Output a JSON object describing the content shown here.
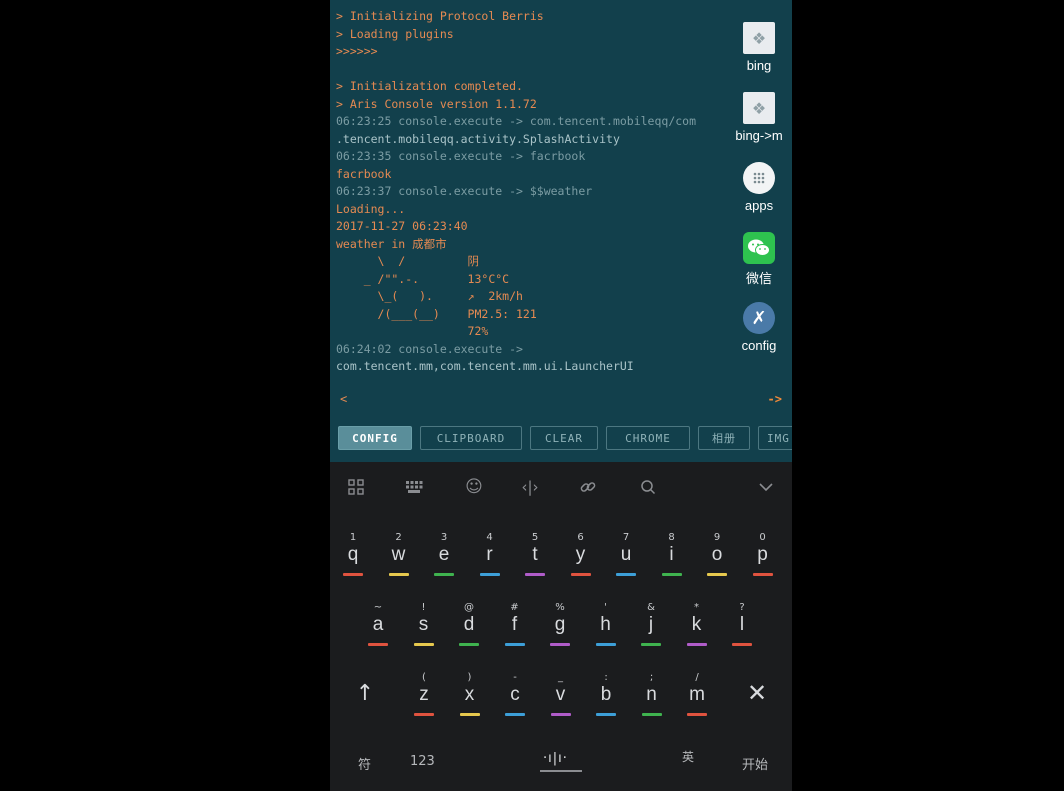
{
  "console": {
    "lines": [
      {
        "text": "> Initializing Protocol Berris",
        "color": "#e58a52"
      },
      {
        "text": "> Loading plugins",
        "color": "#e58a52"
      },
      {
        "text": ">>>>>>",
        "color": "#e58a52"
      },
      {
        "text": "",
        "color": "#e58a52"
      },
      {
        "text": "> Initialization completed.",
        "color": "#e58a52"
      },
      {
        "text": "> Aris Console version 1.1.72",
        "color": "#e58a52"
      },
      {
        "text": "06:23:25 console.execute -> com.tencent.mobileqq/com",
        "color": "#7b9ca3"
      },
      {
        "text": ".tencent.mobileqq.activity.SplashActivity",
        "color": "#a9c3c8"
      },
      {
        "text": "06:23:35 console.execute -> facrbook",
        "color": "#7b9ca3"
      },
      {
        "text": "facrbook",
        "color": "#e58a52"
      },
      {
        "text": "06:23:37 console.execute -> $$weather",
        "color": "#7b9ca3"
      },
      {
        "text": "Loading...",
        "color": "#e58a52"
      },
      {
        "text": "2017-11-27 06:23:40",
        "color": "#e58a52"
      },
      {
        "text": "weather in 成都市",
        "color": "#e58a52"
      },
      {
        "text": "      \\  /         阴",
        "color": "#e58a52"
      },
      {
        "text": "    _ /\"\".-.       13°C°C",
        "color": "#e58a52"
      },
      {
        "text": "      \\_(   ).     ↗  2km/h",
        "color": "#e58a52"
      },
      {
        "text": "      /(___(__)    PM2.5: 121",
        "color": "#e58a52"
      },
      {
        "text": "                   72%",
        "color": "#e58a52"
      },
      {
        "text": "06:24:02 console.execute ->",
        "color": "#7b9ca3"
      },
      {
        "text": "com.tencent.mm,com.tencent.mm.ui.LauncherUI",
        "color": "#a9c3c8"
      }
    ],
    "prompt_left": "<",
    "prompt_right": "->"
  },
  "shortcuts": [
    {
      "label": "bing",
      "icon": "bing-icon"
    },
    {
      "label": "bing->m",
      "icon": "bing-m-icon"
    },
    {
      "label": "apps",
      "icon": "apps-icon"
    },
    {
      "label": "微信",
      "icon": "wechat-icon"
    },
    {
      "label": "config",
      "icon": "config-icon"
    }
  ],
  "toolbar": {
    "buttons": [
      "CONFIG",
      "CLIPBOARD",
      "CLEAR",
      "CHROME",
      "相册",
      "IMG"
    ],
    "active_button": "CONFIG"
  },
  "keyboard": {
    "tools": [
      "grid-icon",
      "keyboard-icon",
      "emoji-icon",
      "cursor-icon",
      "link-icon",
      "search-icon",
      "collapse-icon"
    ],
    "row1": [
      {
        "sym": "1",
        "key": "q",
        "color": "#e0533f"
      },
      {
        "sym": "2",
        "key": "w",
        "color": "#e6c84e"
      },
      {
        "sym": "3",
        "key": "e",
        "color": "#3fb34f"
      },
      {
        "sym": "4",
        "key": "r",
        "color": "#3d9fd8"
      },
      {
        "sym": "5",
        "key": "t",
        "color": "#b05cc9"
      },
      {
        "sym": "6",
        "key": "y",
        "color": "#e0533f"
      },
      {
        "sym": "7",
        "key": "u",
        "color": "#3d9fd8"
      },
      {
        "sym": "8",
        "key": "i",
        "color": "#3fb34f"
      },
      {
        "sym": "9",
        "key": "o",
        "color": "#e6c84e"
      },
      {
        "sym": "0",
        "key": "p",
        "color": "#e0533f"
      }
    ],
    "row2": [
      {
        "sym": "~",
        "key": "a",
        "color": "#e0533f"
      },
      {
        "sym": "!",
        "key": "s",
        "color": "#e6c84e"
      },
      {
        "sym": "@",
        "key": "d",
        "color": "#3fb34f"
      },
      {
        "sym": "#",
        "key": "f",
        "color": "#3d9fd8"
      },
      {
        "sym": "%",
        "key": "g",
        "color": "#b05cc9"
      },
      {
        "sym": "'",
        "key": "h",
        "color": "#3d9fd8"
      },
      {
        "sym": "&",
        "key": "j",
        "color": "#3fb34f"
      },
      {
        "sym": "*",
        "key": "k",
        "color": "#b05cc9"
      },
      {
        "sym": "?",
        "key": "l",
        "color": "#e0533f"
      }
    ],
    "row3": [
      {
        "sym": "(",
        "key": "z",
        "color": "#e0533f"
      },
      {
        "sym": ")",
        "key": "x",
        "color": "#e6c84e"
      },
      {
        "sym": "-",
        "key": "c",
        "color": "#3d9fd8"
      },
      {
        "sym": "_",
        "key": "v",
        "color": "#b05cc9"
      },
      {
        "sym": ":",
        "key": "b",
        "color": "#3d9fd8"
      },
      {
        "sym": ";",
        "key": "n",
        "color": "#3fb34f"
      },
      {
        "sym": "/",
        "key": "m",
        "color": "#e0533f"
      }
    ],
    "shift": "↑",
    "delete": "✕",
    "bottom": {
      "symbols": "符",
      "numbers": "123",
      "voice": "·ı|ı·",
      "lang": "英",
      "go": "开始"
    }
  }
}
